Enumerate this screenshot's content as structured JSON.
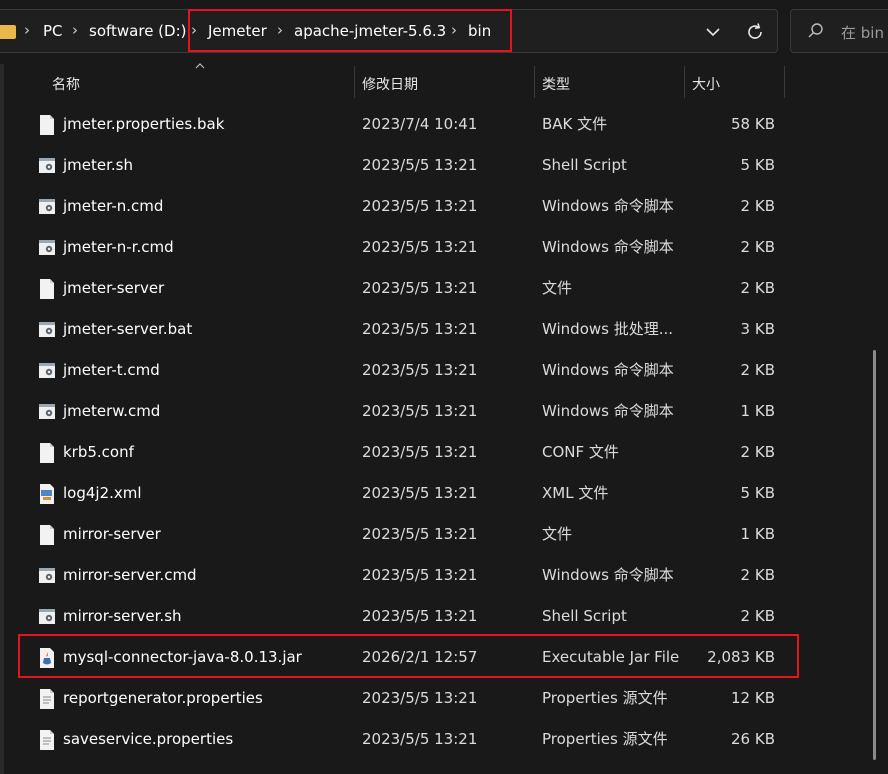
{
  "breadcrumb": {
    "items": [
      "PC",
      "software (D:)",
      "Jemeter",
      "apache-jmeter-5.6.3",
      "bin"
    ],
    "separator": "›"
  },
  "search": {
    "placeholder": "在 bin"
  },
  "columns": {
    "name": "名称",
    "date": "修改日期",
    "type": "类型",
    "size": "大小"
  },
  "files": [
    {
      "name": "jmeter.properties.bak",
      "date": "2023/7/4 10:41",
      "type": "BAK 文件",
      "size": "58 KB",
      "icon": "file-icon"
    },
    {
      "name": "jmeter.sh",
      "date": "2023/5/5 13:21",
      "type": "Shell Script",
      "size": "5 KB",
      "icon": "script-icon"
    },
    {
      "name": "jmeter-n.cmd",
      "date": "2023/5/5 13:21",
      "type": "Windows 命令脚本",
      "size": "2 KB",
      "icon": "script-icon"
    },
    {
      "name": "jmeter-n-r.cmd",
      "date": "2023/5/5 13:21",
      "type": "Windows 命令脚本",
      "size": "2 KB",
      "icon": "script-icon"
    },
    {
      "name": "jmeter-server",
      "date": "2023/5/5 13:21",
      "type": "文件",
      "size": "2 KB",
      "icon": "file-icon"
    },
    {
      "name": "jmeter-server.bat",
      "date": "2023/5/5 13:21",
      "type": "Windows 批处理...",
      "size": "3 KB",
      "icon": "script-icon"
    },
    {
      "name": "jmeter-t.cmd",
      "date": "2023/5/5 13:21",
      "type": "Windows 命令脚本",
      "size": "2 KB",
      "icon": "script-icon"
    },
    {
      "name": "jmeterw.cmd",
      "date": "2023/5/5 13:21",
      "type": "Windows 命令脚本",
      "size": "1 KB",
      "icon": "script-icon"
    },
    {
      "name": "krb5.conf",
      "date": "2023/5/5 13:21",
      "type": "CONF 文件",
      "size": "2 KB",
      "icon": "file-icon"
    },
    {
      "name": "log4j2.xml",
      "date": "2023/5/5 13:21",
      "type": "XML 文件",
      "size": "5 KB",
      "icon": "xml-icon"
    },
    {
      "name": "mirror-server",
      "date": "2023/5/5 13:21",
      "type": "文件",
      "size": "1 KB",
      "icon": "file-icon"
    },
    {
      "name": "mirror-server.cmd",
      "date": "2023/5/5 13:21",
      "type": "Windows 命令脚本",
      "size": "2 KB",
      "icon": "script-icon"
    },
    {
      "name": "mirror-server.sh",
      "date": "2023/5/5 13:21",
      "type": "Shell Script",
      "size": "2 KB",
      "icon": "script-icon"
    },
    {
      "name": "mysql-connector-java-8.0.13.jar",
      "date": "2026/2/1 12:57",
      "type": "Executable Jar File",
      "size": "2,083 KB",
      "icon": "jar-icon"
    },
    {
      "name": "reportgenerator.properties",
      "date": "2023/5/5 13:21",
      "type": "Properties 源文件",
      "size": "12 KB",
      "icon": "properties-icon"
    },
    {
      "name": "saveservice.properties",
      "date": "2023/5/5 13:21",
      "type": "Properties 源文件",
      "size": "26 KB",
      "icon": "properties-icon"
    }
  ],
  "colors": {
    "highlight": "#e1141f",
    "background": "#191919"
  }
}
